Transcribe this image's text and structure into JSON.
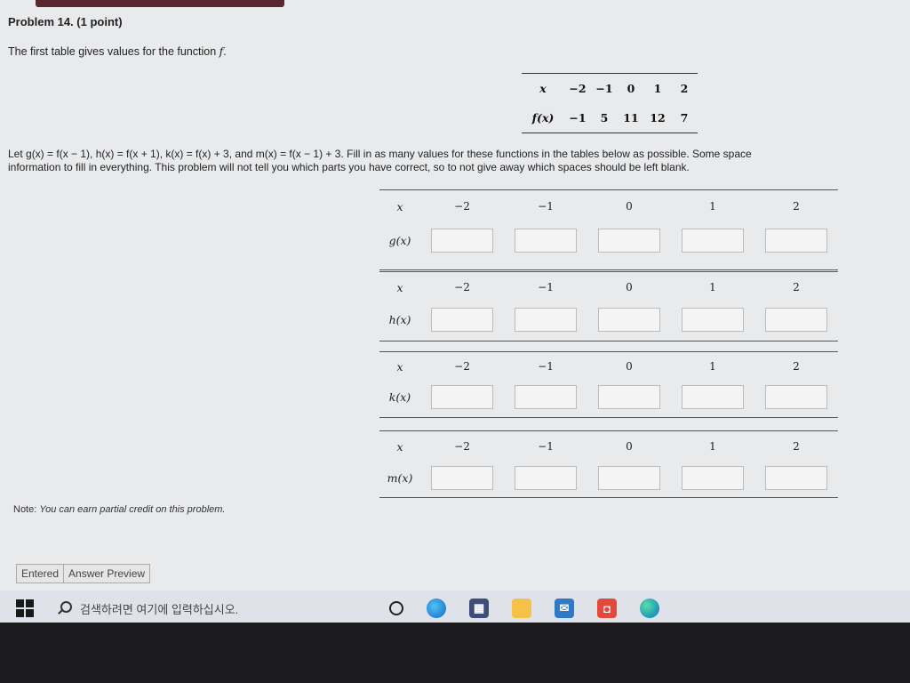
{
  "problem": {
    "title": "Problem 14. (1 point)",
    "intro": "The first table gives values for the function ",
    "intro_fn": "f",
    "intro_end": "."
  },
  "f_table": {
    "x_label": "x",
    "x_values": [
      "−2",
      "−1",
      "0",
      "1",
      "2"
    ],
    "fx_label": "f(x)",
    "fx_values": [
      "−1",
      "5",
      "11",
      "12",
      "7"
    ]
  },
  "instructions": {
    "line1": "Let g(x) = f(x − 1), h(x) = f(x + 1), k(x) = f(x) + 3, and m(x) = f(x − 1) + 3. Fill in as many values for these functions in the tables below as possible. Some space",
    "line2": "information to fill in everything. This problem will not tell you which parts you have correct, so to not give away which spaces should be left blank."
  },
  "function_tables": [
    {
      "x_label": "x",
      "x_values": [
        "−2",
        "−1",
        "0",
        "1",
        "2"
      ],
      "fn_label": "g(x)"
    },
    {
      "x_label": "x",
      "x_values": [
        "−2",
        "−1",
        "0",
        "1",
        "2"
      ],
      "fn_label": "h(x)"
    },
    {
      "x_label": "x",
      "x_values": [
        "−2",
        "−1",
        "0",
        "1",
        "2"
      ],
      "fn_label": "k(x)"
    },
    {
      "x_label": "x",
      "x_values": [
        "−2",
        "−1",
        "0",
        "1",
        "2"
      ],
      "fn_label": "m(x)"
    }
  ],
  "note": {
    "label": "Note:",
    "text": "You can earn partial credit on this problem."
  },
  "result_tabs": [
    "Entered",
    "Answer Preview"
  ],
  "taskbar": {
    "search_placeholder": "검색하려면 여기에 입력하십시오."
  },
  "colors": {
    "page_bg": "#e9eaec",
    "taskbar_bg": "#dfe3e9",
    "header_accent": "#5a2730"
  }
}
